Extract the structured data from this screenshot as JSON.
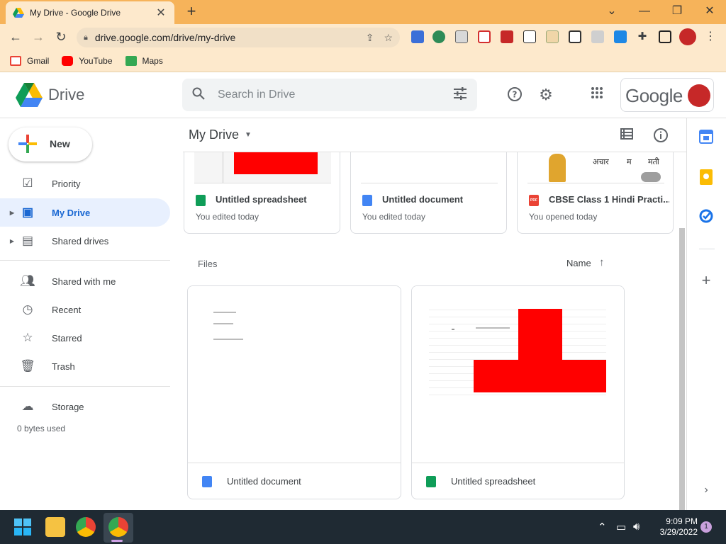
{
  "browser": {
    "tab_title": "My Drive - Google Drive",
    "tab_close": "✕",
    "new_tab": "+",
    "url": "drive.google.com/drive/my-drive",
    "window_minimize": "—",
    "window_restore": "❐",
    "window_close": "✕",
    "window_list": "⌄"
  },
  "bookmarks": [
    {
      "label": "Gmail",
      "color": "#ea4335"
    },
    {
      "label": "YouTube",
      "color": "#ff0000"
    },
    {
      "label": "Maps",
      "color": "#34a853"
    }
  ],
  "header": {
    "title": "Drive",
    "search_placeholder": "Search in Drive",
    "account_wordmark": "Google"
  },
  "sidebar": {
    "new_label": "New",
    "items": [
      {
        "label": "Priority",
        "icon": "check-circle-icon"
      },
      {
        "label": "My Drive",
        "icon": "my-drive-icon"
      },
      {
        "label": "Shared drives",
        "icon": "shared-drives-icon"
      },
      {
        "label": "Shared with me",
        "icon": "people-icon"
      },
      {
        "label": "Recent",
        "icon": "clock-icon"
      },
      {
        "label": "Starred",
        "icon": "star-icon"
      },
      {
        "label": "Trash",
        "icon": "trash-icon"
      },
      {
        "label": "Storage",
        "icon": "cloud-icon"
      }
    ],
    "storage_used": "0 bytes used"
  },
  "main": {
    "breadcrumb": "My Drive",
    "quick_access": [
      {
        "name": "Untitled spreadsheet",
        "sub": "You edited today",
        "type": "sheets"
      },
      {
        "name": "Untitled document",
        "sub": "You edited today",
        "type": "docs"
      },
      {
        "name": "CBSE Class 1 Hindi Practi...",
        "sub": "You opened today",
        "type": "pdf"
      }
    ],
    "hindi_words": [
      "अचार",
      "म",
      "मती"
    ],
    "files_label": "Files",
    "sort_label": "Name",
    "files": [
      {
        "name": "Untitled document",
        "type": "docs"
      },
      {
        "name": "Untitled spreadsheet",
        "type": "sheets"
      }
    ],
    "pdf_badge": "PDF"
  },
  "colors": {
    "accent": "#1967d2",
    "sheets": "#0f9d58",
    "docs": "#4285f4",
    "pdf": "#ea4335",
    "preview_red": "#ff0000"
  },
  "taskbar": {
    "time": "9:09 PM",
    "date": "3/29/2022",
    "notification_count": "1"
  }
}
